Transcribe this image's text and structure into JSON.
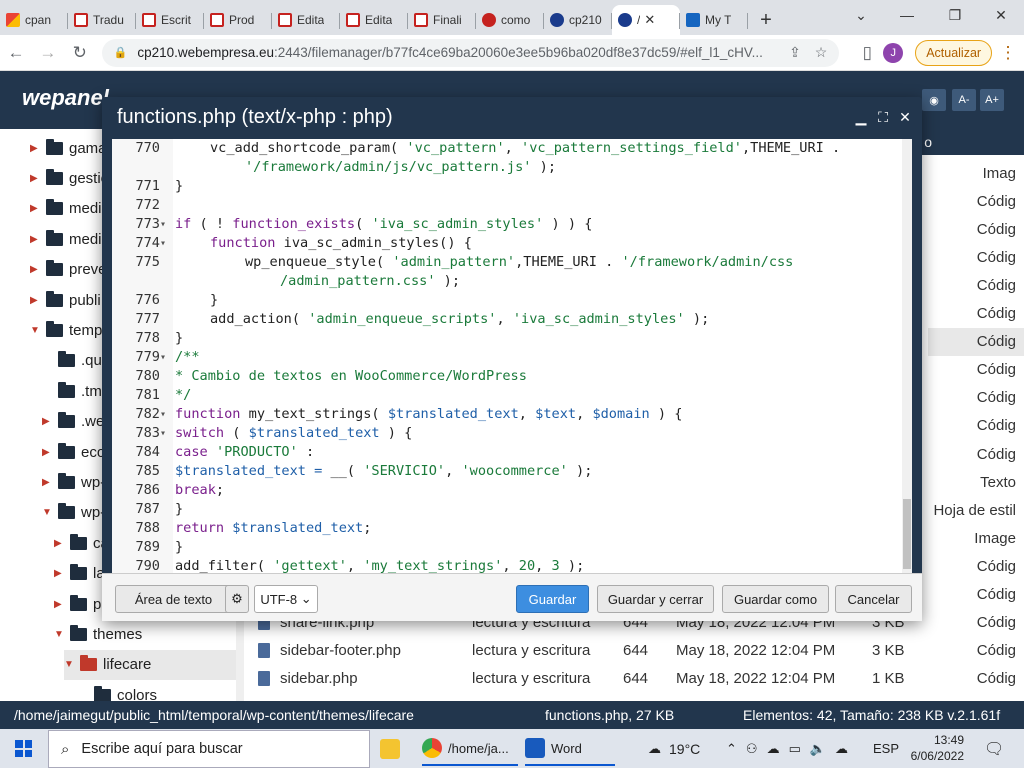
{
  "browser": {
    "tabs": [
      {
        "label": "cpan",
        "icon": "gmail-icon"
      },
      {
        "label": "Tradu",
        "icon": "doc-red-icon"
      },
      {
        "label": "Escrit",
        "icon": "doc-red-icon"
      },
      {
        "label": "Prod",
        "icon": "doc-red-icon"
      },
      {
        "label": "Edita",
        "icon": "doc-red-icon"
      },
      {
        "label": "Edita",
        "icon": "doc-red-icon"
      },
      {
        "label": "Finali",
        "icon": "doc-red-icon"
      },
      {
        "label": "como",
        "icon": "webempresa-icon"
      },
      {
        "label": "cp210",
        "icon": "webmail-icon"
      },
      {
        "label": "/",
        "icon": "webmail-icon"
      },
      {
        "label": "My T",
        "icon": "square-icon"
      }
    ],
    "url_host": "cp210.webempresa.eu",
    "url_rest": ":2443/filemanager/b77fc4ce69ba20060e3ee5b96ba020df8e37dc59/#elf_l1_cHV...",
    "profile_initial": "J",
    "update_label": "Actualizar"
  },
  "app": {
    "logo": "wepanel",
    "font_down": "A-",
    "font_up": "A+"
  },
  "tree": [
    {
      "label": "gama",
      "indent": 0
    },
    {
      "label": "gestio",
      "indent": 0
    },
    {
      "label": "medio",
      "indent": 0
    },
    {
      "label": "medi",
      "indent": 0
    },
    {
      "label": "preve",
      "indent": 0
    },
    {
      "label": "publi",
      "indent": 0
    },
    {
      "label": "temp",
      "indent": 0
    },
    {
      "label": ".qu",
      "indent": 1
    },
    {
      "label": ".tml",
      "indent": 1
    },
    {
      "label": ".we",
      "indent": 1
    },
    {
      "label": "eco",
      "indent": 1
    },
    {
      "label": "wp-",
      "indent": 1
    },
    {
      "label": "wp-",
      "indent": 1
    },
    {
      "label": "ca",
      "indent": 2
    },
    {
      "label": "la",
      "indent": 2
    },
    {
      "label": "pl",
      "indent": 2
    },
    {
      "label": "themes",
      "indent": 2
    },
    {
      "label": "lifecare",
      "indent": 3
    },
    {
      "label": "colors",
      "indent": 4
    }
  ],
  "file_types": [
    "Imag",
    "Códig",
    "Códig",
    "Códig",
    "Códig",
    "Códig",
    "Códig",
    "Códig",
    "Códig",
    "Códig",
    "Códig",
    "Texto",
    "Hoja de estil",
    "Image",
    "Códig",
    "Códig",
    "Códig",
    "Códig",
    "Códig"
  ],
  "files": [
    {
      "name": "share-link.php",
      "perm": "lectura y escritura",
      "mode": "644",
      "date": "May 18, 2022 12:04 PM",
      "size": "3 KB"
    },
    {
      "name": "sidebar-footer.php",
      "perm": "lectura y escritura",
      "mode": "644",
      "date": "May 18, 2022 12:04 PM",
      "size": "3 KB"
    },
    {
      "name": "sidebar.php",
      "perm": "lectura y escritura",
      "mode": "644",
      "date": "May 18, 2022 12:04 PM",
      "size": "1 KB"
    }
  ],
  "status": {
    "path": "/home/jaimegut/public_html/temporal/wp-content/themes/lifecare",
    "file": "functions.php, 27 KB",
    "summary": "Elementos: 42, Tamaño: 238 KB v.2.1.61f"
  },
  "editor": {
    "title": "functions.php (text/x-php : php)",
    "lines": [
      {
        "n": "770",
        "fold": "",
        "indent": 1,
        "parts": [
          [
            "dark",
            "vc_add_shortcode_param( "
          ],
          [
            "str",
            "'vc_pattern'"
          ],
          [
            "dark",
            ", "
          ],
          [
            "str",
            "'vc_pattern_settings_field'"
          ],
          [
            "dark",
            ",THEME_URI ."
          ]
        ]
      },
      {
        "n": "",
        "fold": "",
        "indent": 2,
        "parts": [
          [
            "str",
            "'/framework/admin/js/vc_pattern.js'"
          ],
          [
            "dark",
            " );"
          ]
        ]
      },
      {
        "n": "771",
        "fold": "",
        "indent": 0,
        "parts": [
          [
            "dark",
            "}"
          ]
        ]
      },
      {
        "n": "772",
        "fold": "",
        "indent": 0,
        "parts": []
      },
      {
        "n": "773",
        "fold": "▾",
        "indent": 0,
        "parts": [
          [
            "kw",
            "if"
          ],
          [
            "dark",
            " ( ! "
          ],
          [
            "kw",
            "function_exists"
          ],
          [
            "dark",
            "( "
          ],
          [
            "str",
            "'iva_sc_admin_styles'"
          ],
          [
            "dark",
            " ) ) {"
          ]
        ]
      },
      {
        "n": "774",
        "fold": "▾",
        "indent": 1,
        "parts": [
          [
            "kw",
            "function"
          ],
          [
            "dark",
            " iva_sc_admin_styles() {"
          ]
        ]
      },
      {
        "n": "775",
        "fold": "",
        "indent": 2,
        "parts": [
          [
            "dark",
            "wp_enqueue_style( "
          ],
          [
            "str",
            "'admin_pattern'"
          ],
          [
            "dark",
            ",THEME_URI . "
          ],
          [
            "str",
            "'/framework/admin/css"
          ]
        ]
      },
      {
        "n": "",
        "fold": "",
        "indent": 3,
        "parts": [
          [
            "str",
            "/admin_pattern.css'"
          ],
          [
            "dark",
            " );"
          ]
        ]
      },
      {
        "n": "776",
        "fold": "",
        "indent": 1,
        "parts": [
          [
            "dark",
            "}"
          ]
        ]
      },
      {
        "n": "777",
        "fold": "",
        "indent": 1,
        "parts": [
          [
            "dark",
            "add_action( "
          ],
          [
            "str",
            "'admin_enqueue_scripts'"
          ],
          [
            "dark",
            ", "
          ],
          [
            "str",
            "'iva_sc_admin_styles'"
          ],
          [
            "dark",
            " );"
          ]
        ]
      },
      {
        "n": "778",
        "fold": "",
        "indent": 0,
        "parts": [
          [
            "dark",
            "}"
          ]
        ]
      },
      {
        "n": "779",
        "fold": "▾",
        "indent": 0,
        "parts": [
          [
            "cm",
            "/**"
          ]
        ]
      },
      {
        "n": "780",
        "fold": "",
        "indent": 0,
        "parts": [
          [
            "cm",
            "* Cambio de textos en WooCommerce/WordPress"
          ]
        ]
      },
      {
        "n": "781",
        "fold": "",
        "indent": 0,
        "parts": [
          [
            "cm",
            "*/"
          ]
        ]
      },
      {
        "n": "782",
        "fold": "▾",
        "indent": 0,
        "parts": [
          [
            "kw",
            "function"
          ],
          [
            "dark",
            " my_text_strings( "
          ],
          [
            "var",
            "$translated_text"
          ],
          [
            "dark",
            ", "
          ],
          [
            "var",
            "$text"
          ],
          [
            "dark",
            ", "
          ],
          [
            "var",
            "$domain"
          ],
          [
            "dark",
            " ) {"
          ]
        ]
      },
      {
        "n": "783",
        "fold": "▾",
        "indent": 0,
        "parts": [
          [
            "kw",
            "switch"
          ],
          [
            "dark",
            " ( "
          ],
          [
            "var",
            "$translated_text"
          ],
          [
            "dark",
            " ) {"
          ]
        ]
      },
      {
        "n": "784",
        "fold": "",
        "indent": 0,
        "parts": [
          [
            "kw",
            "case"
          ],
          [
            "dark",
            " "
          ],
          [
            "str",
            "'PRODUCTO'"
          ],
          [
            "dark",
            " :"
          ]
        ]
      },
      {
        "n": "785",
        "fold": "",
        "indent": 0,
        "parts": [
          [
            "var",
            "$translated_text = "
          ],
          [
            "dark",
            "__( "
          ],
          [
            "str",
            "'SERVICIO'"
          ],
          [
            "dark",
            ", "
          ],
          [
            "str",
            "'woocommerce'"
          ],
          [
            "dark",
            " );"
          ]
        ]
      },
      {
        "n": "786",
        "fold": "",
        "indent": 0,
        "parts": [
          [
            "kw",
            "break"
          ],
          [
            "dark",
            ";"
          ]
        ]
      },
      {
        "n": "787",
        "fold": "",
        "indent": 0,
        "parts": [
          [
            "dark",
            "}"
          ]
        ]
      },
      {
        "n": "788",
        "fold": "",
        "indent": 0,
        "parts": [
          [
            "kw",
            "return"
          ],
          [
            "dark",
            " "
          ],
          [
            "var",
            "$translated_text"
          ],
          [
            "dark",
            ";"
          ]
        ]
      },
      {
        "n": "789",
        "fold": "",
        "indent": 0,
        "parts": [
          [
            "dark",
            "}"
          ]
        ]
      },
      {
        "n": "790",
        "fold": "",
        "indent": 0,
        "parts": [
          [
            "dark",
            "add_filter( "
          ],
          [
            "str",
            "'gettext'"
          ],
          [
            "dark",
            ", "
          ],
          [
            "str",
            "'my_text_strings'"
          ],
          [
            "dark",
            ", "
          ],
          [
            "str",
            "20"
          ],
          [
            "dark",
            ", "
          ],
          [
            "str",
            "3"
          ],
          [
            "dark",
            " );"
          ]
        ]
      }
    ],
    "btn_textarea": "Área de texto",
    "encoding": "UTF-8",
    "btn_save": "Guardar",
    "btn_save_close": "Guardar y cerrar",
    "btn_save_as": "Guardar como",
    "btn_cancel": "Cancelar"
  },
  "taskbar": {
    "search_placeholder": "Escribe aquí para buscar",
    "chrome_label": "/home/ja...",
    "word_label": "Word",
    "temperature": "19°C",
    "language": "ESP",
    "time": "13:49",
    "date": "6/06/2022"
  }
}
